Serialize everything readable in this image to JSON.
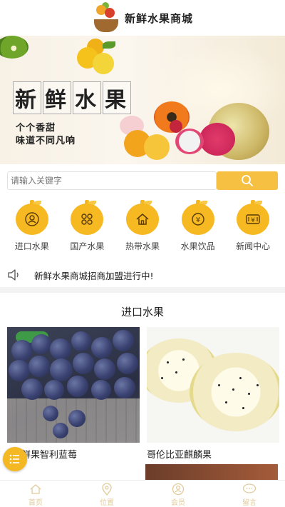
{
  "header": {
    "title": "新鲜水果商城"
  },
  "banner": {
    "headline_chars": [
      "新",
      "鲜",
      "水",
      "果"
    ],
    "sub1": "个个香甜",
    "sub2": "味道不同凡响"
  },
  "search": {
    "placeholder": "请输入关键字",
    "button_icon": "search-icon"
  },
  "categories": [
    {
      "label": "进口水果",
      "icon": "user-circle-icon"
    },
    {
      "label": "国产水果",
      "icon": "clover-icon"
    },
    {
      "label": "热带水果",
      "icon": "home-icon"
    },
    {
      "label": "水果饮品",
      "icon": "yen-coin-icon"
    },
    {
      "label": "新闻中心",
      "icon": "yen-ticket-icon"
    }
  ],
  "notice": {
    "text": "新鲜水果商城招商加盟进行中!",
    "icon": "speaker-icon"
  },
  "section": {
    "title": "进口水果",
    "products": [
      {
        "name": "鲜果智利蓝莓"
      },
      {
        "name": "哥伦比亚麒麟果"
      }
    ]
  },
  "fab": {
    "icon": "menu-list-icon"
  },
  "tabbar": [
    {
      "label": "首页",
      "icon": "home-icon"
    },
    {
      "label": "位置",
      "icon": "location-pin-icon"
    },
    {
      "label": "会员",
      "icon": "member-icon"
    },
    {
      "label": "留言",
      "icon": "chat-icon"
    }
  ],
  "colors": {
    "accent": "#f6b922",
    "background": "#f3f3f3"
  }
}
